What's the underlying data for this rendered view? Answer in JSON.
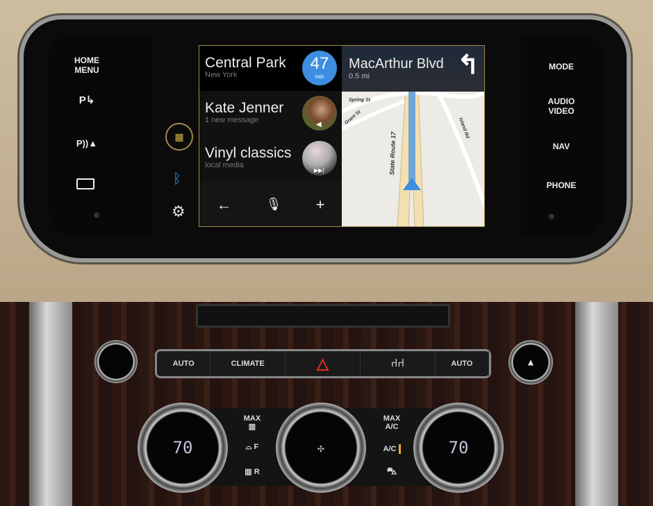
{
  "hardware_left": {
    "home_menu": "HOME\nMENU",
    "icons": [
      "park-exit-icon",
      "park-distance-icon",
      "camera-icon"
    ]
  },
  "hardware_right": {
    "mode": "MODE",
    "audio_video": "AUDIO\nVIDEO",
    "nav": "NAV",
    "phone": "PHONE"
  },
  "side_rail": {
    "icons": [
      "apps-grid-icon",
      "bluetooth-icon",
      "settings-gear-icon"
    ],
    "accent": "#c9a94a",
    "bluetooth_color": "#3a8fd8"
  },
  "cards": [
    {
      "title": "Central Park",
      "subtitle": "New York",
      "eta_value": "47",
      "eta_unit": "min",
      "badge_color": "#3d8ee0"
    },
    {
      "title": "Kate Jenner",
      "subtitle": "1 new message",
      "icon": "speaker-icon"
    },
    {
      "title": "Vinyl classics",
      "subtitle": "local media",
      "icon": "skip-next-icon"
    }
  ],
  "bottom_bar": {
    "icons": [
      "back-arrow-icon",
      "microphone-icon",
      "plus-icon"
    ]
  },
  "navigation": {
    "street": "MacArthur Blvd",
    "distance": "0.5 mi",
    "turn": "turn-left-icon",
    "labels": [
      "Spring St",
      "Grant St",
      "State Route 17",
      "Island Rd"
    ],
    "route_color": "#6fa8d8"
  },
  "climate": {
    "buttons": [
      "AUTO",
      "CLIMATE",
      "hazard-icon",
      "seat-heat-icon",
      "AUTO"
    ],
    "left_temp": "70",
    "right_temp": "70",
    "left_labels": {
      "max": "MAX",
      "front": "F",
      "rear": "R"
    },
    "right_labels": {
      "max_ac": "MAX\nA/C",
      "ac": "A/C"
    },
    "ac_indicator_color": "#f0b020"
  }
}
